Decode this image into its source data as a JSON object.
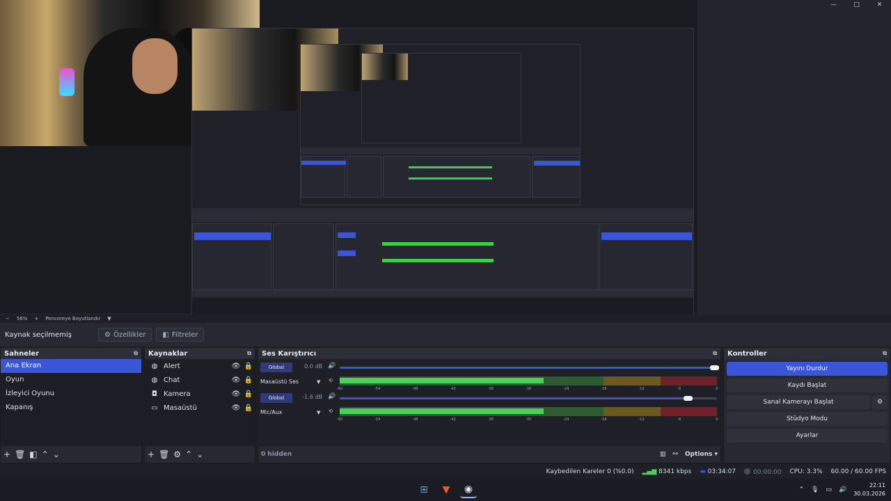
{
  "window": {
    "minimize": "—",
    "maximize": "□",
    "close": "✕"
  },
  "preview": {
    "zoom": "56%",
    "fit_label": "Pencereye Boyutlandır",
    "zoom_minus": "−",
    "zoom_plus": "+"
  },
  "toolbar": {
    "selection_label": "Kaynak seçilmemiş",
    "properties_label": "Özellikler",
    "filters_label": "Filtreler"
  },
  "scenes": {
    "title": "Sahneler",
    "items": [
      "Ana Ekran",
      "Oyun",
      "İzleyici Oyunu",
      "Kapanış"
    ],
    "active_index": 0
  },
  "sources": {
    "title": "Kaynaklar",
    "items": [
      {
        "label": "Alert",
        "icon": "globe-icon"
      },
      {
        "label": "Chat",
        "icon": "globe-icon"
      },
      {
        "label": "Kamera",
        "icon": "camera-icon"
      },
      {
        "label": "Masaüstü",
        "icon": "monitor-icon"
      }
    ]
  },
  "mixer": {
    "title": "Ses Karıştırıcı",
    "tracks": [
      {
        "button": "Global",
        "db": "0.0 dB",
        "name": "Masaüstü Ses",
        "level": 1.0
      },
      {
        "button": "Global",
        "db": "-1.6 dB",
        "name": "Mic/Aux",
        "level": 0.93
      }
    ],
    "scale": [
      "-60",
      "-54",
      "-48",
      "-42",
      "-36",
      "-30",
      "-24",
      "-18",
      "-12",
      "-6",
      "0"
    ],
    "hidden_label": "0 hidden",
    "options_label": "Options"
  },
  "controls": {
    "title": "Kontroller",
    "stop_stream": "Yayını Durdur",
    "start_record": "Kaydı Başlat",
    "virtual_cam": "Sanal Kamerayı Başlat",
    "studio_mode": "Stüdyo Modu",
    "settings": "Ayarlar"
  },
  "status": {
    "dropped": "Kaybedilen Kareler 0 (%0.0)",
    "bitrate": "8341 kbps",
    "stream_time": "03:34:07",
    "record_time": "00:00:00",
    "cpu": "CPU: 3.3%",
    "fps": "60.00 / 60.00 FPS"
  },
  "taskbar": {
    "time": "22:11",
    "date": "30.03.2026"
  },
  "colors": {
    "accent": "#3a56d6",
    "meter_green": "#49d15a",
    "meter_yellow": "#6a5a21",
    "meter_red": "#6e2128"
  }
}
